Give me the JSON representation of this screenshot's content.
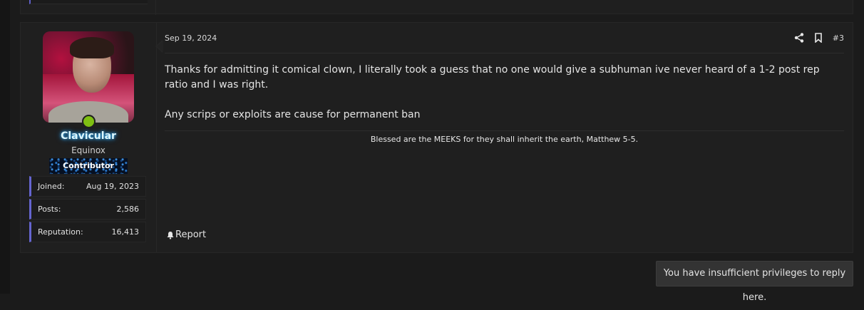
{
  "post": {
    "date": "Sep 19, 2024",
    "number": "#3",
    "message": [
      "Thanks for admitting it comical clown, I literally took a guess that no one would give a subhuman ive never heard of a 1-2 post rep ratio and I was right.",
      "Any scrips or exploits are cause for permanent ban"
    ],
    "signature": "Blessed are the MEEKS for they shall inherit the earth, Matthew 5-5.",
    "report_label": "Report",
    "icons": {
      "share": "share-icon",
      "bookmark": "bookmark-icon",
      "report": "bell-icon"
    }
  },
  "user": {
    "name": "Clavicular",
    "title": "Equinox",
    "banner": "Contributor",
    "online": true,
    "stats": [
      {
        "label": "Joined:",
        "value": "Aug 19, 2023"
      },
      {
        "label": "Posts:",
        "value": "2,586"
      },
      {
        "label": "Reputation:",
        "value": "16,413"
      }
    ]
  },
  "notice": "You have insufficient privileges to reply here.",
  "colors": {
    "background": "#1b1b1b",
    "panel": "#1f1f1f",
    "accent": "#6565d0",
    "online": "#7fbf12",
    "username_glow": "#3ab8ff"
  }
}
